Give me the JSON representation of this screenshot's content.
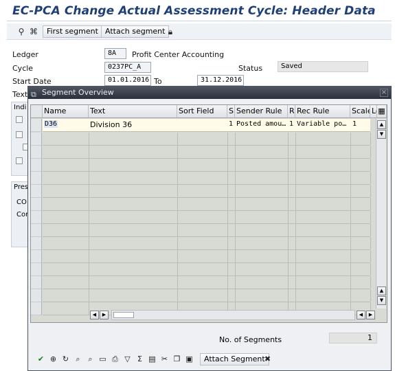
{
  "window": {
    "title": "EC-PCA Change Actual Assessment Cycle: Header Data"
  },
  "app_toolbar": {
    "buttons": [
      {
        "label": "First segment"
      },
      {
        "label": "Attach segment"
      }
    ],
    "icons": [
      "person-hierarchy-icon",
      "binoculars-icon",
      "lock-icon"
    ]
  },
  "header": {
    "ledger_label": "Ledger",
    "ledger_value": "8A",
    "ledger_desc": "Profit Center Accounting",
    "cycle_label": "Cycle",
    "cycle_value": "0237PC_A",
    "status_label": "Status",
    "status_value": "Saved",
    "start_date_label": "Start Date",
    "start_date_value": "01.01.2016",
    "to_label": "To",
    "to_value": "31.12.2016",
    "text_label": "Text"
  },
  "background_fragments": {
    "indicators_label": "Indi",
    "pres_label": "Pres",
    "co_label": "CO",
    "cor_label": "Cor"
  },
  "dialog": {
    "title": "Segment Overview",
    "columns": [
      "Name",
      "Text",
      "Sort Field",
      "S",
      "Sender Rule",
      "R",
      "Rec Rule",
      "Scale",
      "Lo"
    ],
    "rows": [
      {
        "name": "D36",
        "text": "Division 36",
        "sort_field": "",
        "s": "1",
        "sender_rule": "Posted amou…",
        "r": "1",
        "rec_rule": "Variable po…",
        "scale": "1",
        "lo": ""
      }
    ],
    "segment_count_label": "No. of Segments",
    "segment_count_value": "1",
    "bottom_toolbar": {
      "attach_label": "Attach Segment",
      "icons": [
        "checkmark-icon",
        "zoom-icon",
        "refresh-icon",
        "find-icon",
        "find-next-icon",
        "print-preview-icon",
        "print-icon",
        "filter-icon",
        "sum-icon",
        "subtotal-icon",
        "cut-icon",
        "copy-icon",
        "paste-icon"
      ],
      "cancel_icon": "cancel-icon"
    }
  },
  "colors": {
    "title": "#1f3f7a",
    "dialog_title_bar": "#2b303a",
    "grid_bg": "#d7dbd4",
    "selected_cell": "#fffbe8"
  }
}
